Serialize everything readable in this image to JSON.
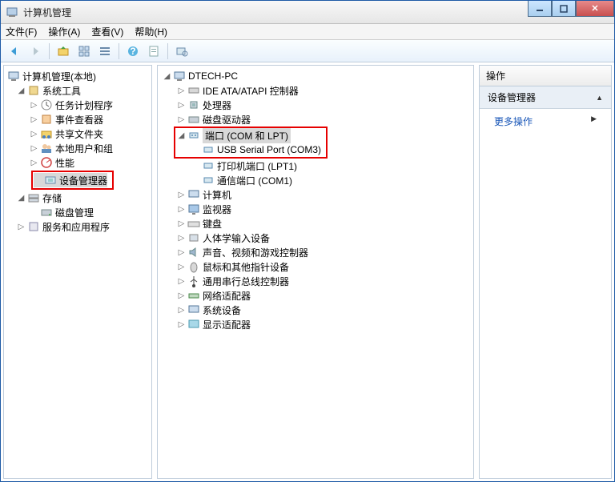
{
  "window": {
    "title": "计算机管理"
  },
  "menu": {
    "file": "文件(F)",
    "action": "操作(A)",
    "view": "查看(V)",
    "help": "帮助(H)"
  },
  "left": {
    "root": "计算机管理(本地)",
    "sys_tools": "系统工具",
    "task_scheduler": "任务计划程序",
    "event_viewer": "事件查看器",
    "shared_folders": "共享文件夹",
    "local_users": "本地用户和组",
    "performance": "性能",
    "device_manager": "设备管理器",
    "storage": "存储",
    "disk_mgmt": "磁盘管理",
    "services_apps": "服务和应用程序"
  },
  "main": {
    "root": "DTECH-PC",
    "ide": "IDE ATA/ATAPI 控制器",
    "cpu": "处理器",
    "disk_drives": "磁盘驱动器",
    "ports": "端口 (COM 和 LPT)",
    "usb_serial": "USB Serial Port (COM3)",
    "printer_port": "打印机端口 (LPT1)",
    "comm_port": "通信端口 (COM1)",
    "computer": "计算机",
    "monitor": "监视器",
    "keyboard": "键盘",
    "hid": "人体学输入设备",
    "sound": "声音、视频和游戏控制器",
    "mouse": "鼠标和其他指针设备",
    "usb": "通用串行总线控制器",
    "network": "网络适配器",
    "system_devices": "系统设备",
    "display": "显示适配器"
  },
  "right": {
    "header": "操作",
    "section": "设备管理器",
    "more": "更多操作"
  }
}
